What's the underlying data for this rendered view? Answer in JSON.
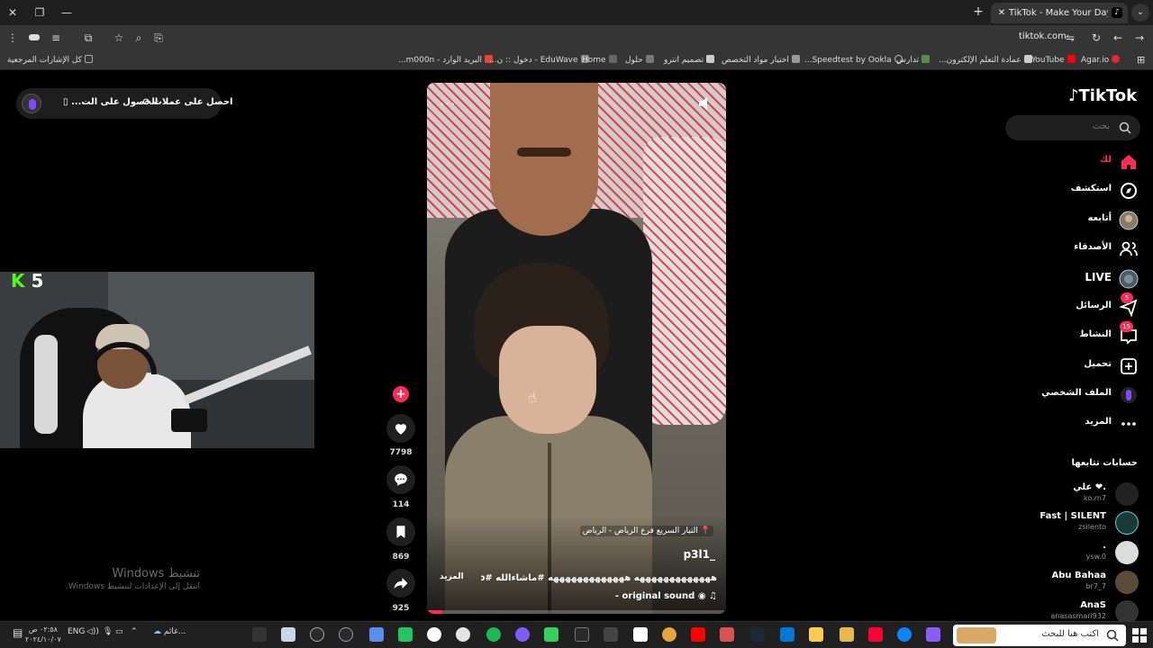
{
  "browser": {
    "tab_title": "TikTok - Make Your Day",
    "url": "tiktok.com",
    "bookmarks": [
      "كل الإشارات المرجعية",
      "البريد الوارد - m000n...",
      "EduWave - دخول :: ن...",
      "Home",
      "حلول",
      "تصميم انترو",
      "اختيار مواد التخصص",
      "Speedtest by Ookla...",
      "تدارس",
      "عمادة التعلم الإلكترون...",
      "YouTube",
      "Agar.io"
    ]
  },
  "coins": {
    "get_coins": "احصل على عملات",
    "get_app": "الحصول على الت..."
  },
  "stream": {
    "kick_count": "5"
  },
  "video": {
    "location": "التيار السريع فرع الرياض - الرياض",
    "author": "p3l1_",
    "caption": "هههههههههههههه هههههههههههههه #ماشاءالله #fyp ...",
    "more": "المزيد",
    "sound": "original sound -",
    "progress_fraction": 0.05
  },
  "actions": {
    "likes": "7798",
    "comments": "114",
    "saves": "869",
    "shares": "925"
  },
  "sidebar": {
    "logo": "TikTok",
    "search_placeholder": "بحث",
    "nav": [
      {
        "label": "لك",
        "icon": "home-icon"
      },
      {
        "label": "استكشف",
        "icon": "compass-icon"
      },
      {
        "label": "أتابعه",
        "icon": "following-avatar-icon"
      },
      {
        "label": "الأصدقاء",
        "icon": "friends-icon"
      },
      {
        "label": "LIVE",
        "icon": "live-icon"
      },
      {
        "label": "الرسائل",
        "icon": "messages-icon",
        "badge": "5"
      },
      {
        "label": "النشاط",
        "icon": "activity-icon",
        "badge": "15"
      },
      {
        "label": "تحميل",
        "icon": "upload-icon"
      },
      {
        "label": "الملف الشخصي",
        "icon": "profile-icon"
      },
      {
        "label": "المزيد",
        "icon": "more-icon"
      }
    ],
    "following_title": "حسابات تتابعها",
    "accounts": [
      {
        "name": "علي ❤.",
        "handle": "ko.rn7"
      },
      {
        "name": "Fast | SILENT",
        "handle": "zsilento"
      },
      {
        "name": ".",
        "handle": "ysw.0"
      },
      {
        "name": "Abu Bahaa",
        "handle": "br7_7"
      },
      {
        "name": "AnaS",
        "handle": "anasasmari932"
      }
    ]
  },
  "windows": {
    "activate_title": "تنشيط Windows",
    "activate_sub": "انتقل إلى الإعدادات لتنشيط Windows."
  },
  "taskbar": {
    "search_placeholder": "اكتب هنا للبحث",
    "weather": "غائم...",
    "lang": "ENG",
    "time": "٠٢:٥٨ ص",
    "date": "٢٠٢٤/١٠/٠٧"
  },
  "colors": {
    "accent": "#fe2c55",
    "kick_green": "#53fc18"
  }
}
